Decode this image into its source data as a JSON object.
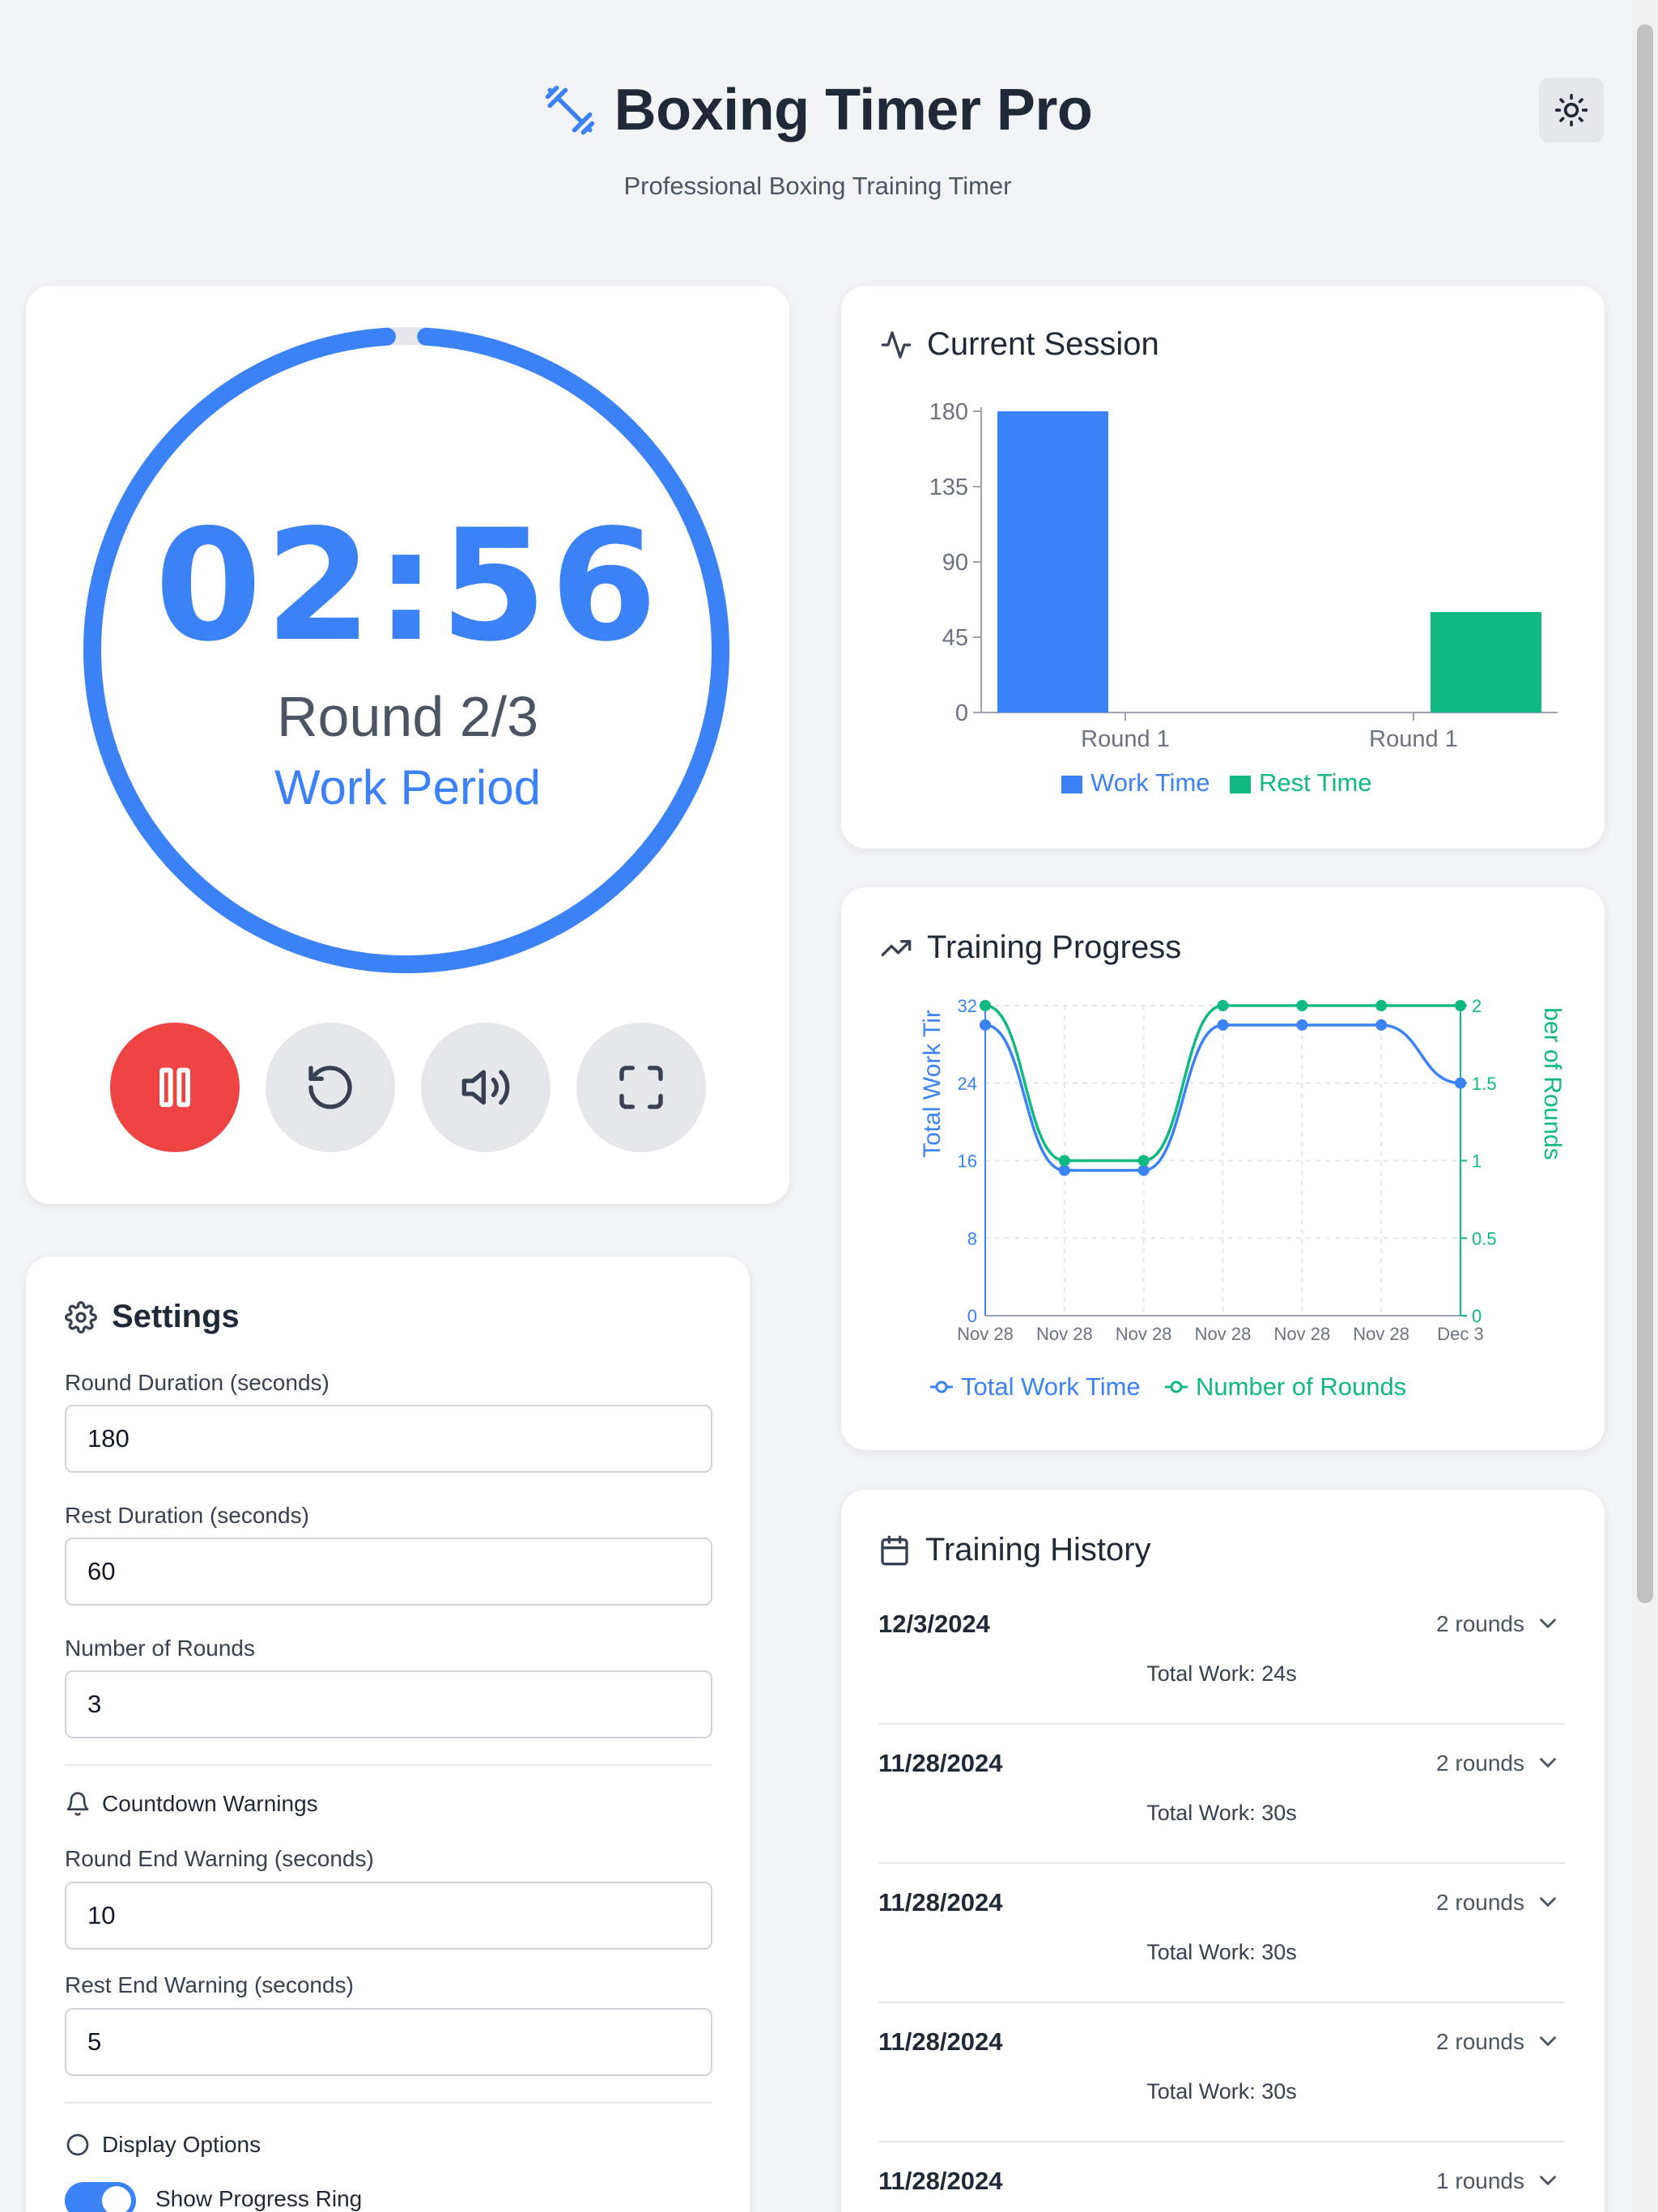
{
  "app": {
    "title": "Boxing Timer Pro",
    "subtitle": "Professional Boxing Training Timer",
    "theme_icon": "sun-icon",
    "colors": {
      "accent": "#3b82f6",
      "rest": "#10b981",
      "danger": "#ef4444",
      "background": "#f3f4f6"
    }
  },
  "timer": {
    "time": "02:56",
    "round": "Round 2/3",
    "period": "Work Period",
    "progress": 0.98,
    "controls": [
      {
        "name": "pause",
        "icon": "pause-icon"
      },
      {
        "name": "reset",
        "icon": "reset-icon"
      },
      {
        "name": "sound",
        "icon": "volume-icon"
      },
      {
        "name": "fullscreen",
        "icon": "fullscreen-icon"
      }
    ]
  },
  "session": {
    "title": "Current Session",
    "icon": "activity-icon"
  },
  "progress_section": {
    "title": "Training Progress",
    "icon": "trending-up-icon"
  },
  "chart_data": [
    {
      "type": "bar",
      "categories": [
        "Round 1",
        "Round 1"
      ],
      "series": [
        {
          "name": "Work Time",
          "values": [
            180,
            0
          ],
          "color": "#3b82f6"
        },
        {
          "name": "Rest Time",
          "values": [
            0,
            60
          ],
          "color": "#10b981"
        }
      ],
      "yticks": [
        "0",
        "45",
        "90",
        "135",
        "180"
      ],
      "ylim": [
        0,
        180
      ],
      "legend": "bottom"
    },
    {
      "type": "line",
      "x": [
        "Nov 28",
        "Nov 28",
        "Nov 28",
        "Nov 28",
        "Nov 28",
        "Nov 28",
        "Dec 3"
      ],
      "series": [
        {
          "name": "Total Work Time",
          "values": [
            30,
            15,
            15,
            30,
            30,
            30,
            24
          ],
          "axis": "left",
          "color": "#3b82f6"
        },
        {
          "name": "Number of Rounds",
          "values": [
            2,
            1,
            1,
            2,
            2,
            2,
            2
          ],
          "axis": "right",
          "color": "#10b981"
        }
      ],
      "ylabel_left": "Total Work Tir",
      "ylabel_right": "ber of Rounds",
      "yticks_left": [
        "0",
        "8",
        "16",
        "24",
        "32"
      ],
      "yticks_right": [
        "0",
        "0.5",
        "1",
        "1.5",
        "2"
      ],
      "ylim_left": [
        0,
        32
      ],
      "ylim_right": [
        0,
        2
      ],
      "grid": true,
      "legend": "bottom"
    }
  ],
  "settings": {
    "title": "Settings",
    "icon": "gear-icon",
    "fields": [
      {
        "label": "Round Duration (seconds)",
        "value": "180"
      },
      {
        "label": "Rest Duration (seconds)",
        "value": "60"
      },
      {
        "label": "Number of Rounds",
        "value": "3"
      }
    ],
    "warnings": {
      "title": "Countdown Warnings",
      "icon": "bell-icon",
      "fields": [
        {
          "label": "Round End Warning (seconds)",
          "value": "10"
        },
        {
          "label": "Rest End Warning (seconds)",
          "value": "5"
        }
      ]
    },
    "display": {
      "title": "Display Options",
      "icon": "circle-icon",
      "toggle_label": "Show Progress Ring",
      "toggle_on": true
    }
  },
  "history": {
    "title": "Training History",
    "icon": "calendar-icon",
    "items": [
      {
        "date": "12/3/2024",
        "rounds": "2 rounds",
        "total": "Total Work: 24s"
      },
      {
        "date": "11/28/2024",
        "rounds": "2 rounds",
        "total": "Total Work: 30s"
      },
      {
        "date": "11/28/2024",
        "rounds": "2 rounds",
        "total": "Total Work: 30s"
      },
      {
        "date": "11/28/2024",
        "rounds": "2 rounds",
        "total": "Total Work: 30s"
      },
      {
        "date": "11/28/2024",
        "rounds": "1 rounds",
        "total": ""
      }
    ]
  }
}
